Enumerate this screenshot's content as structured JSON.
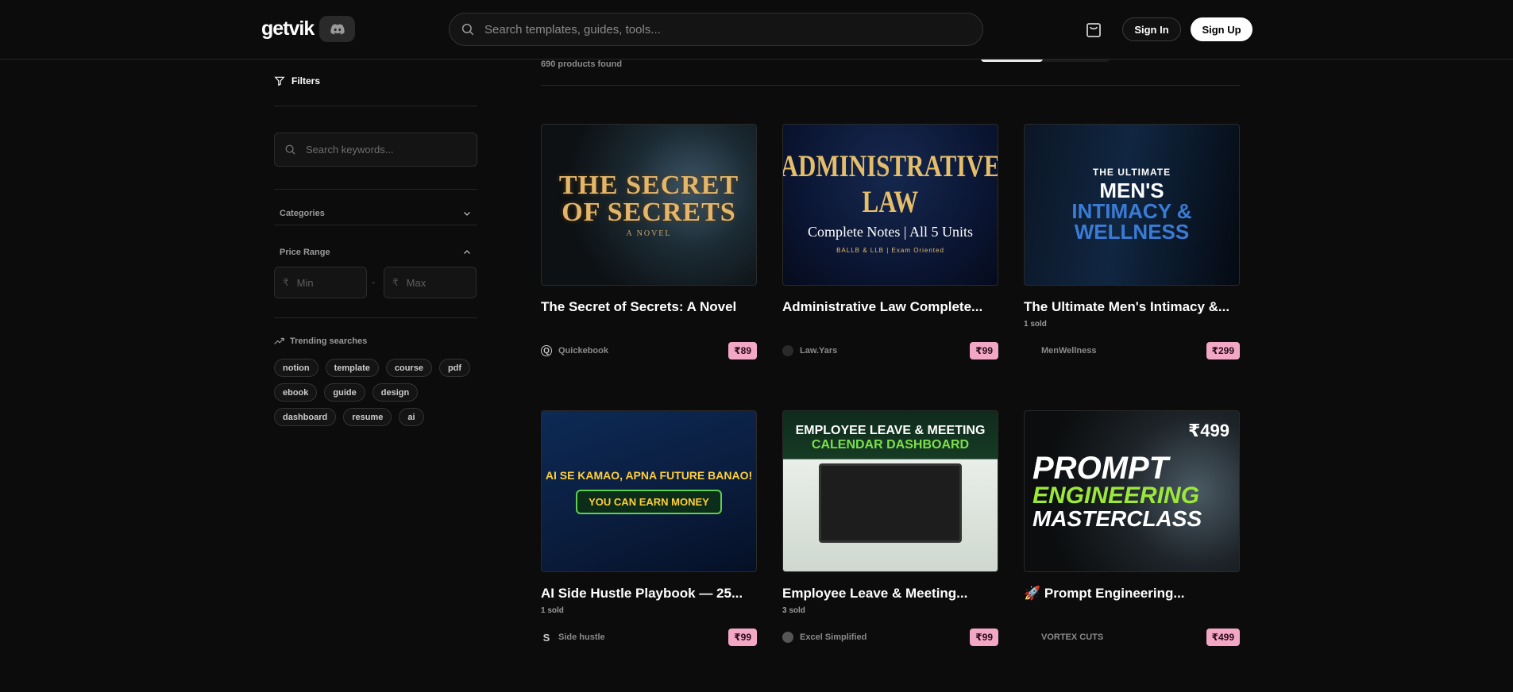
{
  "header": {
    "logo": "getvik",
    "search_placeholder": "Search templates, guides, tools...",
    "sign_in": "Sign In",
    "sign_up": "Sign Up"
  },
  "sidebar": {
    "filters_label": "Filters",
    "keyword_placeholder": "Search keywords...",
    "categories_label": "Categories",
    "price_range_label": "Price Range",
    "currency_symbol": "₹",
    "min_placeholder": "Min",
    "max_placeholder": "Max",
    "price_separator": "-",
    "trending_label": "Trending searches",
    "tags": [
      "notion",
      "template",
      "course",
      "pdf",
      "ebook",
      "guide",
      "design",
      "dashboard",
      "resume",
      "ai"
    ]
  },
  "main": {
    "products_found": "690 products found",
    "products": [
      {
        "title": "The Secret of Secrets: A Novel",
        "sold": "",
        "seller": "Quickebook",
        "seller_initial": "Q",
        "price": "₹89",
        "art": {
          "line1": "THE SECRET",
          "line2": "OF SECRETS",
          "line3": "A NOVEL"
        }
      },
      {
        "title": "Administrative Law Complete...",
        "sold": "",
        "seller": "Law.Yars",
        "seller_initial": "",
        "price": "₹99",
        "art": {
          "line1": "ADMINISTRATIVE LAW",
          "line2": "Complete Notes | All 5 Units",
          "line3": "BALLB & LLB | Exam Oriented"
        }
      },
      {
        "title": "The Ultimate Men's Intimacy &...",
        "sold": "1 sold",
        "seller": "MenWellness",
        "seller_initial": "",
        "price": "₹299",
        "art": {
          "line1": "THE ULTIMATE",
          "line2": "MEN'S",
          "line3": "INTIMACY &",
          "line4": "WELLNESS"
        }
      },
      {
        "title": "AI Side Hustle Playbook — 25...",
        "sold": "1 sold",
        "seller": "Side hustle",
        "seller_initial": "S",
        "price": "₹99",
        "art": {
          "line1": "AI SE KAMAO, APNA FUTURE BANAO!",
          "line2": "YOU CAN",
          "line3": "EARN MONEY"
        }
      },
      {
        "title": "Employee Leave & Meeting...",
        "sold": "3 sold",
        "seller": "Excel Simplified",
        "seller_initial": "",
        "price": "₹99",
        "art": {
          "line1": "EMPLOYEE LEAVE & MEETING",
          "line2": "CALENDAR DASHBOARD"
        }
      },
      {
        "title": "🚀 Prompt Engineering...",
        "sold": "",
        "seller": "VORTEX CUTS",
        "seller_initial": "",
        "price": "₹499",
        "art": {
          "line1": "PROMPT",
          "line2": "ENGINEERING",
          "line3": "MASTERCLASS",
          "price": "₹499"
        }
      }
    ]
  }
}
